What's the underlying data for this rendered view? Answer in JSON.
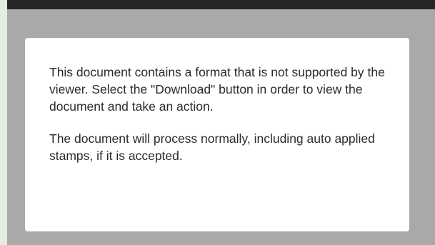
{
  "colors": {
    "page_background": "#e1efdc",
    "viewer_background": "#a9a9a9",
    "topbar": "#262626",
    "card": "#ffffff",
    "text": "#2b2b2b"
  },
  "message": {
    "paragraph_1": "This document contains a format that is not supported by the viewer. Select the \"Download\" button in order to view the document and take an action.",
    "paragraph_2": "The document will process normally, including auto applied stamps, if it is accepted."
  }
}
